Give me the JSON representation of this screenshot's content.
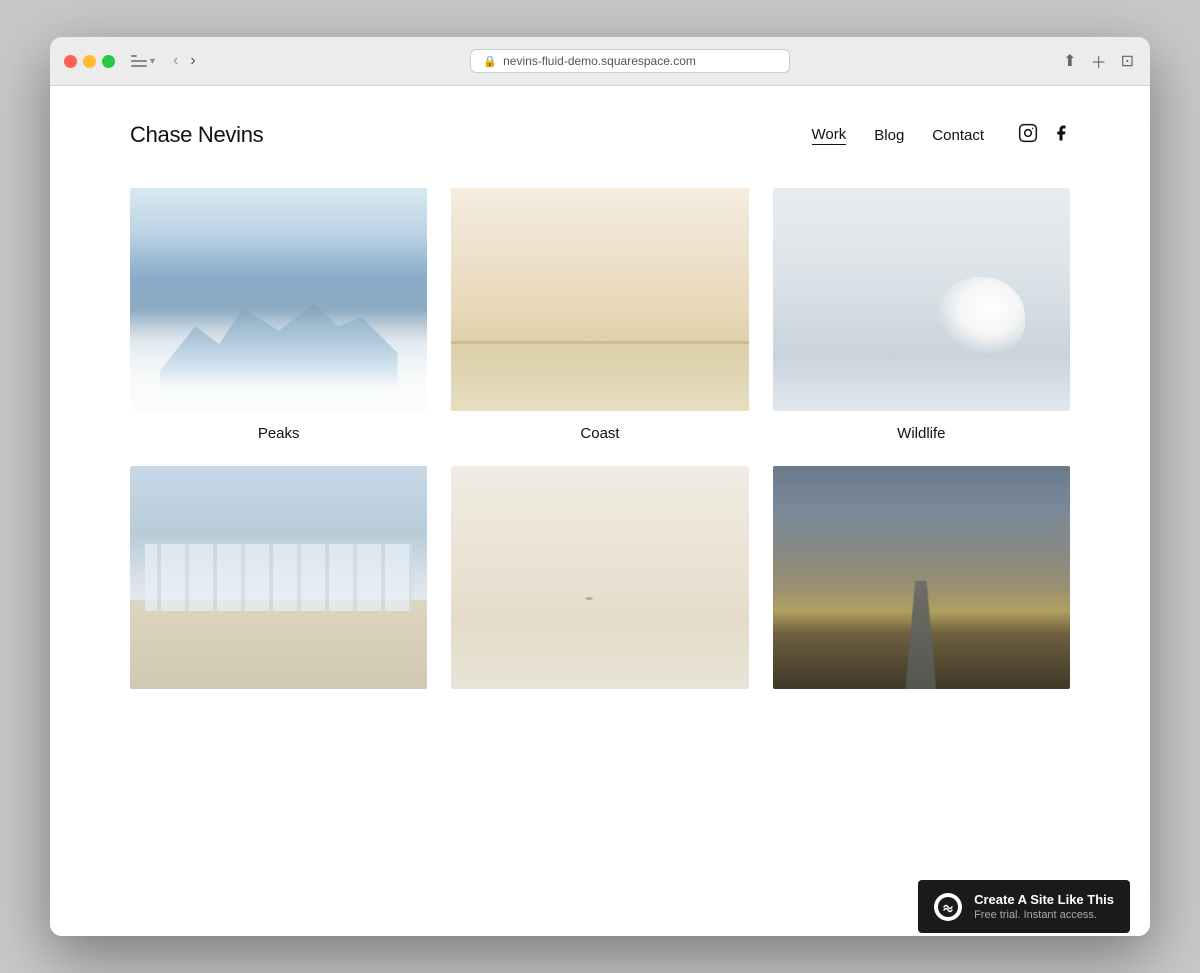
{
  "browser": {
    "url": "nevins-fluid-demo.squarespace.com",
    "back_label": "‹",
    "forward_label": "›"
  },
  "site": {
    "title": "Chase Nevins",
    "nav": {
      "links": [
        {
          "label": "Work",
          "active": true
        },
        {
          "label": "Blog",
          "active": false
        },
        {
          "label": "Contact",
          "active": false
        }
      ]
    }
  },
  "gallery": {
    "row1": [
      {
        "id": "peaks",
        "caption": "Peaks",
        "img_class": "img-peaks"
      },
      {
        "id": "coast",
        "caption": "Coast",
        "img_class": "img-coast"
      },
      {
        "id": "wildlife",
        "caption": "Wildlife",
        "img_class": "img-wildlife"
      }
    ],
    "row2": [
      {
        "id": "beach-chairs",
        "caption": "",
        "img_class": "img-beach-chairs"
      },
      {
        "id": "misty-water",
        "caption": "",
        "img_class": "img-misty-water"
      },
      {
        "id": "highland",
        "caption": "",
        "img_class": "img-highland"
      }
    ]
  },
  "badge": {
    "main": "Create A Site Like This",
    "sub": "Free trial. Instant access."
  }
}
